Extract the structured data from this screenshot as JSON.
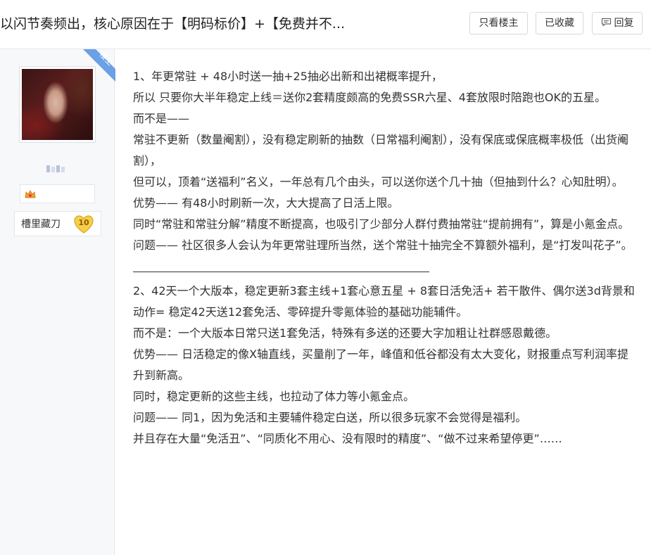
{
  "header": {
    "title": "以闪节奏频出，核心原因在于【明码标价】+【免费并不...",
    "buttons": {
      "only_op": "只看楼主",
      "favorited": "已收藏",
      "reply": "回复"
    }
  },
  "sidebar": {
    "op_badge": "楼主",
    "level": {
      "name": "槽里藏刀",
      "value": "10"
    }
  },
  "post": {
    "p1": "1、年更常驻 + 48小时送一抽+25抽必出新和出裙概率提升，",
    "p2": "所以 只要你大半年稳定上线＝送你2套精度颇高的免费SSR六星、4套放限时陪跑也OK的五星。",
    "p3": "而不是——",
    "p4": "常驻不更新（数量阉割），没有稳定刷新的抽数（日常福利阉割），没有保底或保底概率极低（出货阉割），",
    "p5": "但可以，顶着“送福利”名义，一年总有几个由头，可以送你送个几十抽（但抽到什么？心知肚明）。",
    "p6": "优势—— 有48小时刷新一次，大大提高了日活上限。",
    "p7": "同时“常驻和常驻分解”精度不断提高，也吸引了少部分人群付费抽常驻“提前拥有”，算是小氪金点。",
    "p8": "问题—— 社区很多人会认为年更常驻理所当然，送个常驻十抽完全不算额外福利，是“打发叫花子”。",
    "q1": "2、42天一个大版本，稳定更新3套主线+1套心意五星 + 8套日活免活+ 若干散件、偶尔送3d背景和动作= 稳定42天送12套免活、零碎提升零氪体验的基础功能辅件。",
    "q2": "而不是：一个大版本日常只送1套免活，特殊有多送的还要大字加粗让社群感恩戴德。",
    "q3": "优势—— 日活稳定的像X轴直线，买量削了一年，峰值和低谷都没有太大变化，财报重点写利润率提升到新高。",
    "q4": "同时，稳定更新的这些主线，也拉动了体力等小氪金点。",
    "q5": "问题—— 同1，因为免活和主要辅件稳定白送，所以很多玩家不会觉得是福利。",
    "q6": "并且存在大量“免活丑”、“同质化不用心、没有限时的精度”、“做不过来希望停更”……"
  },
  "colors": {
    "op_ribbon": "#6aa0e6",
    "level_badge": "#f3c53a",
    "sidebar_bg": "#f7f8fa",
    "border": "#e4e6eb"
  }
}
